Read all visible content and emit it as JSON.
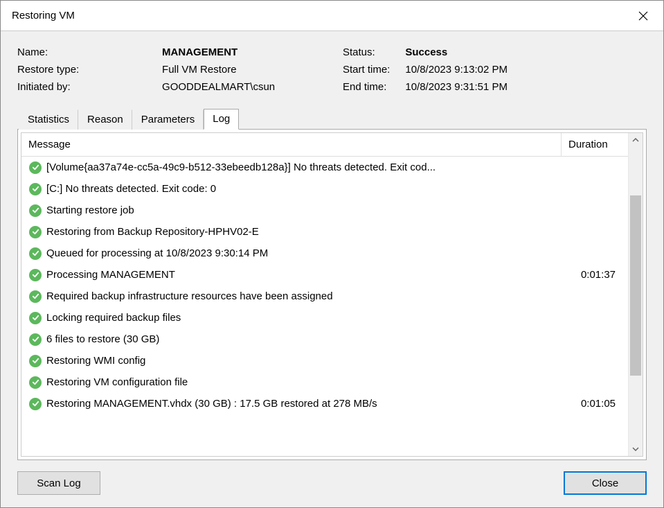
{
  "window": {
    "title": "Restoring VM"
  },
  "info": {
    "name_label": "Name:",
    "name_value": "MANAGEMENT",
    "restore_type_label": "Restore type:",
    "restore_type_value": "Full VM Restore",
    "initiated_by_label": "Initiated by:",
    "initiated_by_value": "GOODDEALMART\\csun",
    "status_label": "Status:",
    "status_value": "Success",
    "start_time_label": "Start time:",
    "start_time_value": "10/8/2023 9:13:02 PM",
    "end_time_label": "End time:",
    "end_time_value": "10/8/2023 9:31:51 PM"
  },
  "tabs": {
    "statistics": "Statistics",
    "reason": "Reason",
    "parameters": "Parameters",
    "log": "Log"
  },
  "log_table": {
    "header_message": "Message",
    "header_duration": "Duration",
    "rows": [
      {
        "msg": "[Volume{aa37a74e-cc5a-49c9-b512-33ebeedb128a}] No threats detected. Exit cod...",
        "dur": ""
      },
      {
        "msg": "[C:] No threats detected. Exit code: 0",
        "dur": ""
      },
      {
        "msg": "Starting restore job",
        "dur": ""
      },
      {
        "msg": "Restoring from Backup Repository-HPHV02-E",
        "dur": ""
      },
      {
        "msg": "Queued for processing at 10/8/2023 9:30:14 PM",
        "dur": ""
      },
      {
        "msg": "Processing MANAGEMENT",
        "dur": "0:01:37"
      },
      {
        "msg": "Required backup infrastructure resources have been assigned",
        "dur": ""
      },
      {
        "msg": "Locking required backup files",
        "dur": ""
      },
      {
        "msg": "6 files to restore (30 GB)",
        "dur": ""
      },
      {
        "msg": "Restoring WMI config",
        "dur": ""
      },
      {
        "msg": "Restoring VM configuration file",
        "dur": ""
      },
      {
        "msg": "Restoring MANAGEMENT.vhdx (30 GB) : 17.5 GB restored at 278 MB/s",
        "dur": "0:01:05"
      }
    ]
  },
  "buttons": {
    "scan_log": "Scan Log",
    "close": "Close"
  }
}
